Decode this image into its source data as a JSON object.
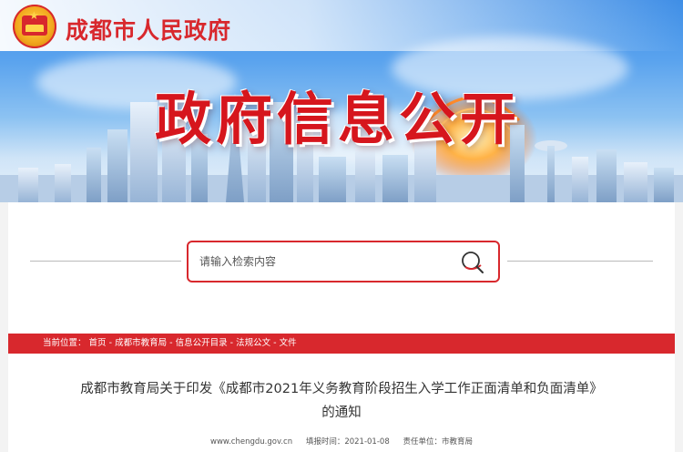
{
  "header": {
    "site_title": "成都市人民政府",
    "hero_title": "政府信息公开"
  },
  "search": {
    "placeholder": "请输入检索内容"
  },
  "breadcrumb": {
    "prefix": "当前位置：",
    "separator": " - ",
    "items": [
      "首页",
      "成都市教育局",
      "信息公开目录",
      "法规公文",
      "文件"
    ]
  },
  "article": {
    "title_line1": "成都市教育局关于印发《成都市2021年义务教育阶段招生入学工作正面清单和负面清单》",
    "title_line2": "的通知",
    "source_url": "www.chengdu.gov.cn",
    "date_label": "填报时间：",
    "date": "2021-01-08",
    "unit_label": "责任单位：",
    "unit": "市教育局"
  },
  "colors": {
    "brand_red": "#d8282d",
    "sky_blue": "#4a97e8"
  }
}
